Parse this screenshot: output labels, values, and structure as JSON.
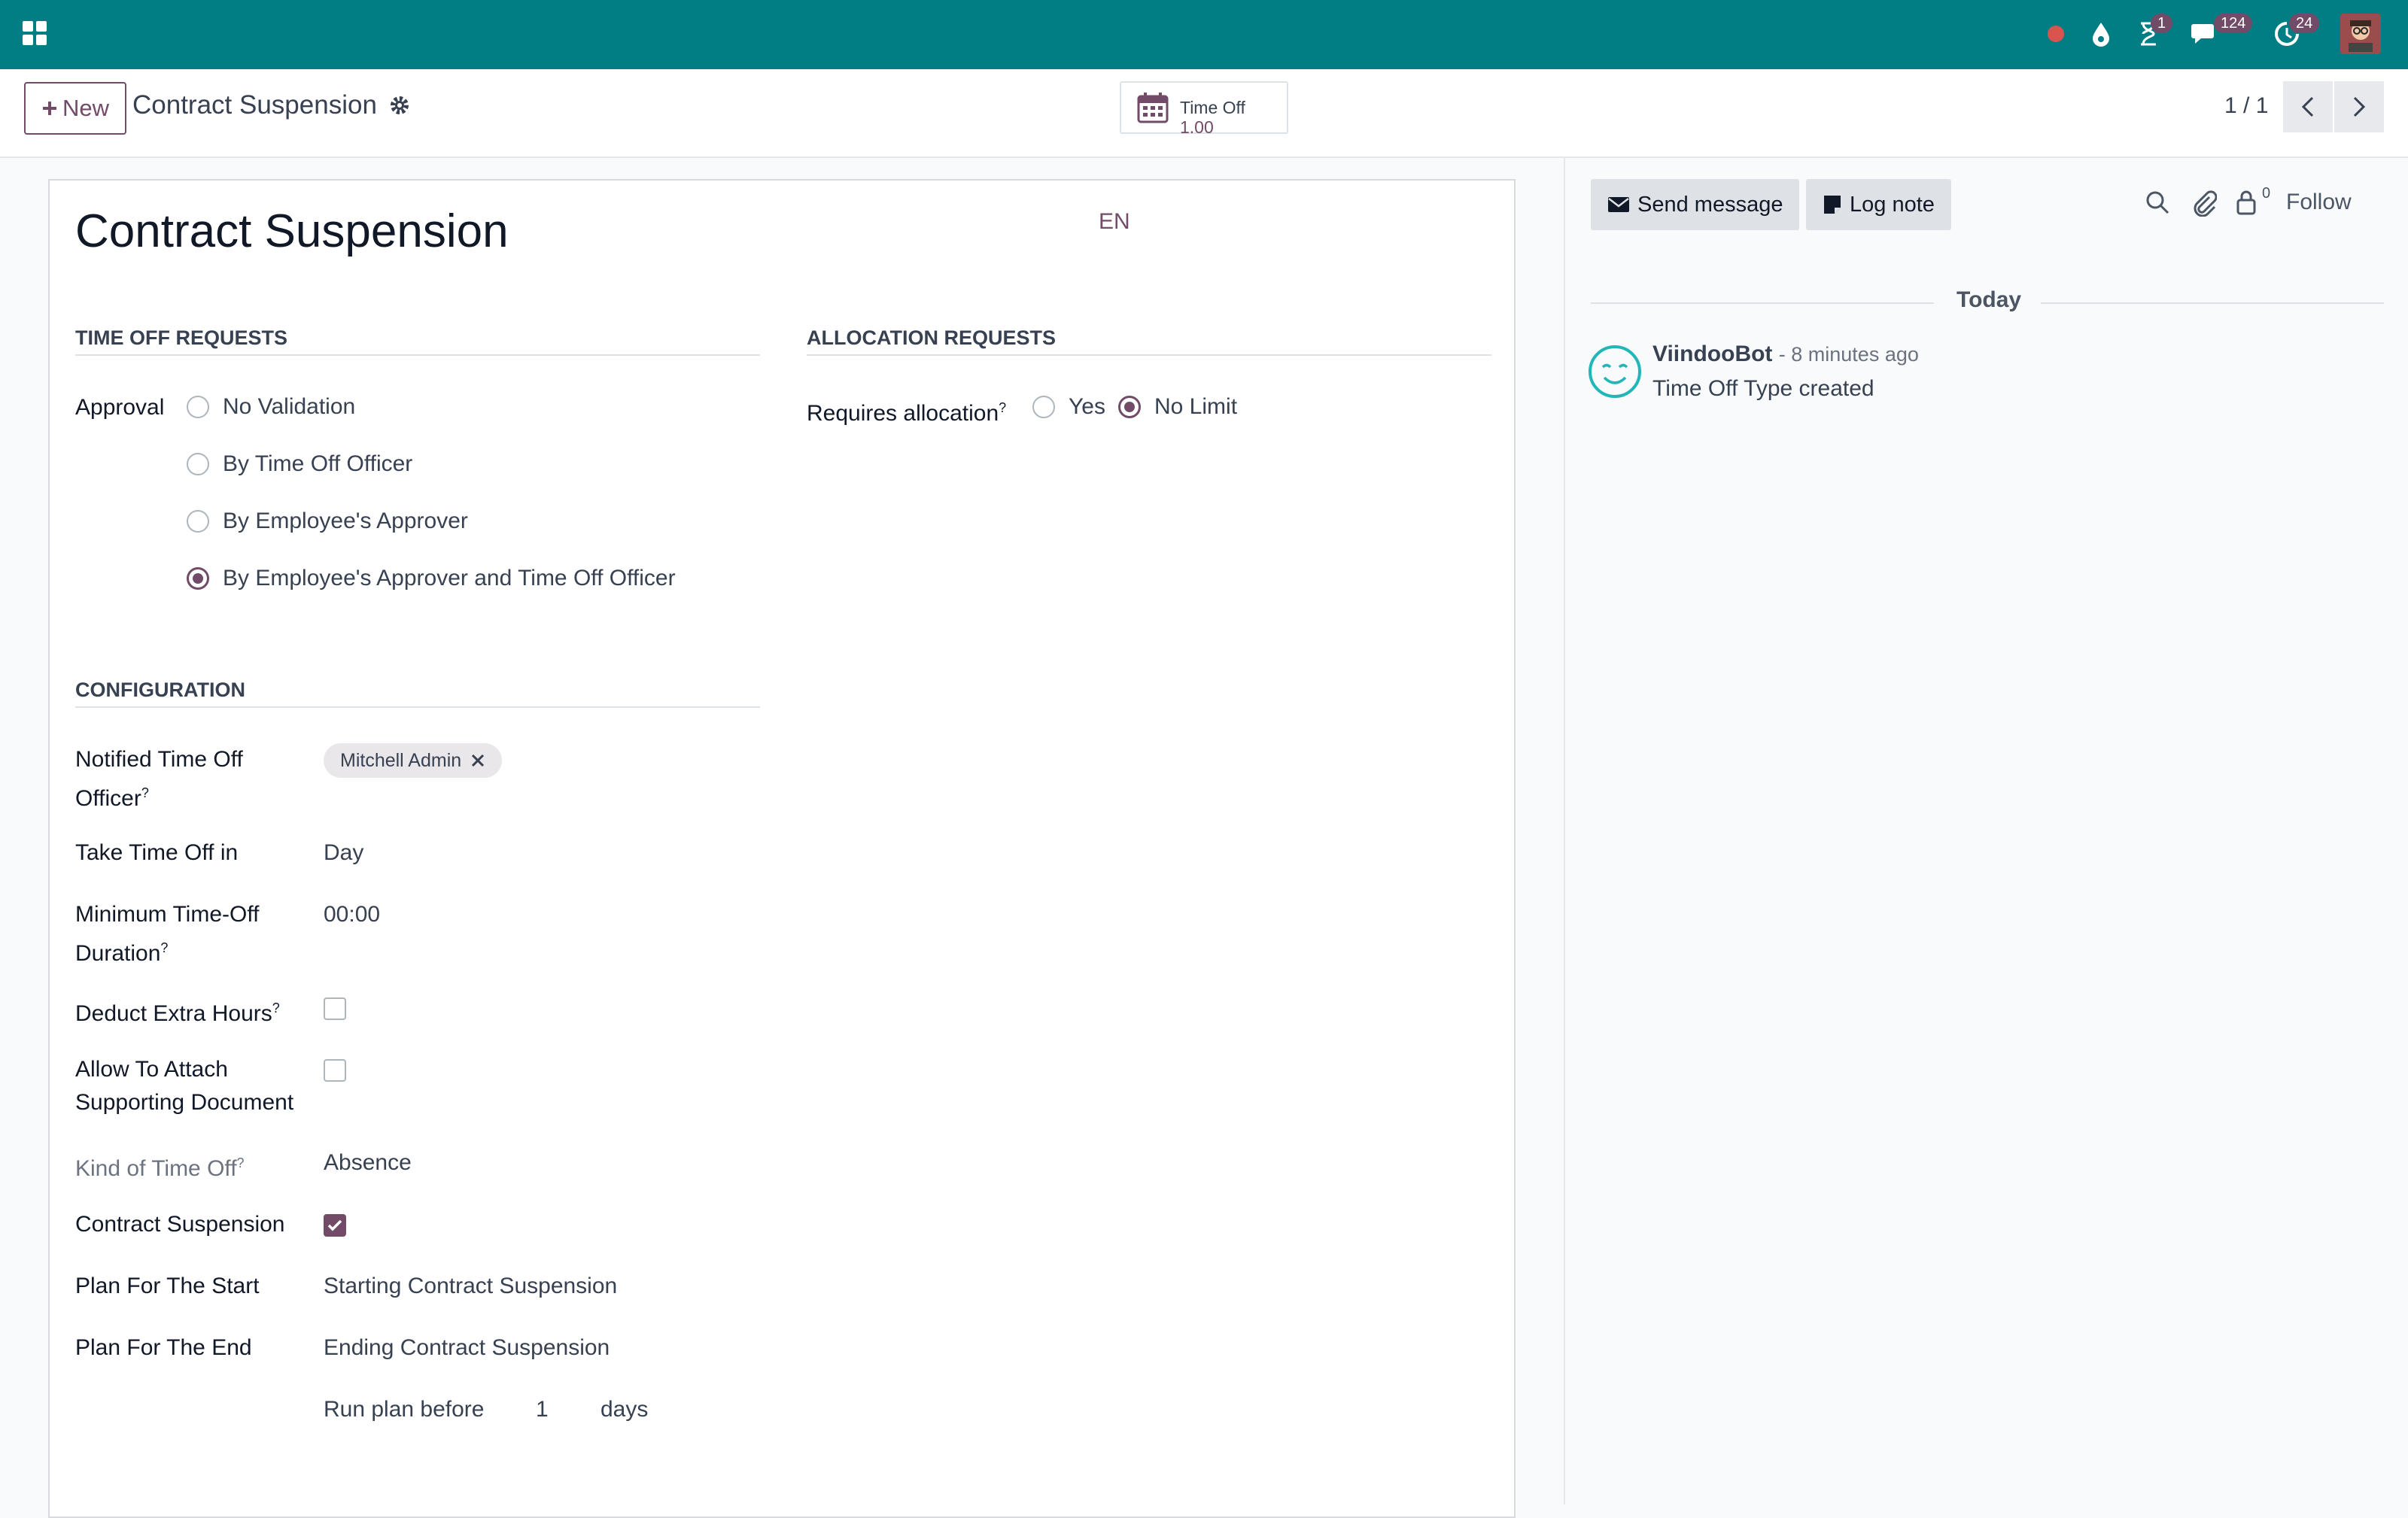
{
  "navbar": {
    "badges": {
      "activities": "1",
      "messages": "124",
      "updates": "24"
    }
  },
  "control": {
    "new_label": "New",
    "breadcrumb": "Contract Suspension",
    "smart_button": {
      "label": "Time Off",
      "value": "1.00"
    },
    "pager": "1 / 1"
  },
  "form": {
    "title": "Contract Suspension",
    "lang": "EN",
    "time_off_requests": {
      "heading": "TIME OFF REQUESTS",
      "approval_label": "Approval",
      "options": [
        "No Validation",
        "By Time Off Officer",
        "By Employee's Approver",
        "By Employee's Approver and Time Off Officer"
      ],
      "selected": 3
    },
    "allocation_requests": {
      "heading": "ALLOCATION REQUESTS",
      "label": "Requires allocation",
      "help": "?",
      "options": [
        "Yes",
        "No Limit"
      ],
      "selected": 1
    },
    "configuration": {
      "heading": "CONFIGURATION",
      "notified_label_1": "Notified Time Off",
      "notified_label_2": "Officer",
      "notified_tag": "Mitchell Admin",
      "take_time_off_label": "Take Time Off in",
      "take_time_off_value": "Day",
      "min_duration_label_1": "Minimum Time-Off",
      "min_duration_label_2": "Duration",
      "min_duration_value": "00:00",
      "deduct_label": "Deduct Extra Hours",
      "deduct_checked": false,
      "attach_label_1": "Allow To Attach",
      "attach_label_2": "Supporting Document",
      "attach_checked": false,
      "kind_label": "Kind of Time Off",
      "kind_value": "Absence",
      "suspension_label": "Contract Suspension",
      "suspension_checked": true,
      "plan_start_label": "Plan For The Start",
      "plan_start_value": "Starting Contract Suspension",
      "plan_end_label": "Plan For The End",
      "plan_end_value": "Ending Contract Suspension",
      "run_plan_before": "Run plan before",
      "run_plan_days_value": "1",
      "run_plan_days_unit": "days",
      "help": "?"
    }
  },
  "chatter": {
    "send_message": "Send message",
    "log_note": "Log note",
    "followers_count": "0",
    "follow": "Follow",
    "today": "Today",
    "author": "ViindooBot",
    "time": "- 8 minutes ago",
    "message": "Time Off Type created"
  },
  "colors": {
    "navbar": "#017e84",
    "primary": "#714b67"
  }
}
